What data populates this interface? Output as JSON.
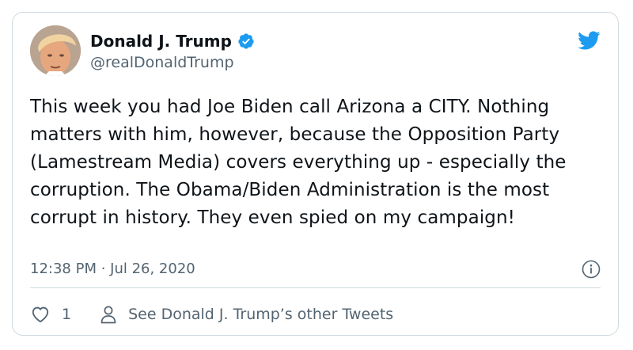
{
  "tweet": {
    "author": {
      "display_name": "Donald J. Trump",
      "handle": "@realDonaldTrump",
      "verified": true
    },
    "text": "This week you had Joe Biden call Arizona a CITY. Nothing matters with him, however, because the Opposition Party (Lamestream Media) covers everything up - especially the corruption. The Obama/Biden Administration is the most corrupt in history. They even spied on my campaign!",
    "timestamp": "12:38 PM · Jul 26, 2020",
    "likes": "1",
    "profile_link_label": "See Donald J. Trump’s other Tweets"
  },
  "icons": {
    "brand": "twitter-bird-icon",
    "verified": "verified-badge-icon",
    "info": "info-icon",
    "like": "heart-icon",
    "profile": "person-icon"
  },
  "colors": {
    "brand_blue": "#1d9bf0",
    "text_primary": "#0f1419",
    "text_secondary": "#536471",
    "border": "#cfd9de"
  }
}
